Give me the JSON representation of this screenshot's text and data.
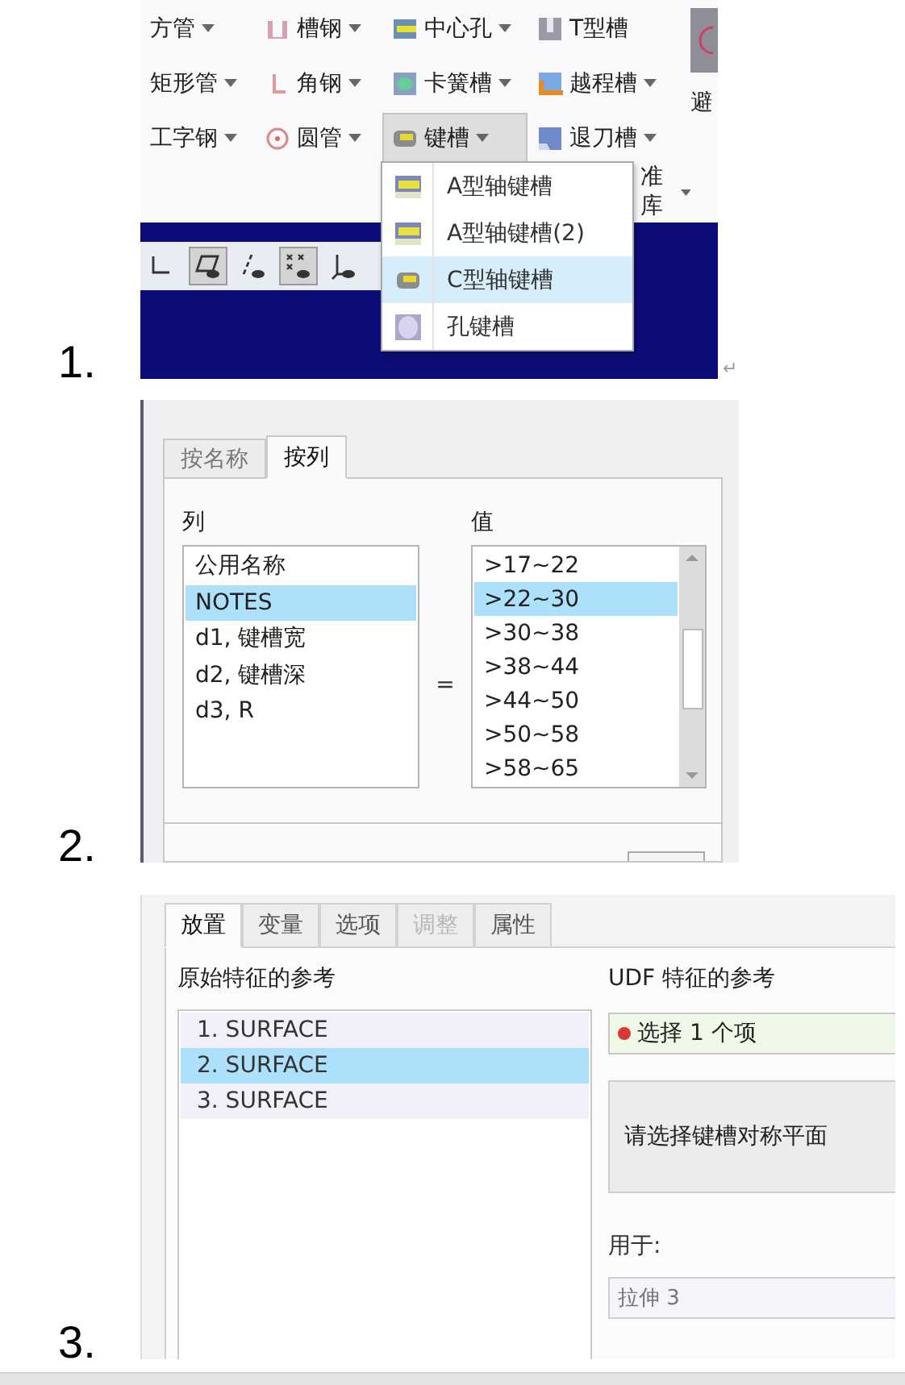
{
  "figure_1": {
    "number": "1.",
    "ribbon_rows": [
      [
        {
          "label": "方管",
          "has_dropdown": true,
          "selected": false
        },
        {
          "label": "槽钢",
          "has_dropdown": true,
          "selected": false
        },
        {
          "label": "中心孔",
          "has_dropdown": true,
          "selected": false
        },
        {
          "label": "T型槽",
          "has_dropdown": false,
          "selected": false
        }
      ],
      [
        {
          "label": "矩形管",
          "has_dropdown": true,
          "selected": false
        },
        {
          "label": "角钢",
          "has_dropdown": true,
          "selected": false
        },
        {
          "label": "卡簧槽",
          "has_dropdown": true,
          "selected": false
        },
        {
          "label": "越程槽",
          "has_dropdown": true,
          "selected": false
        }
      ],
      [
        {
          "label": "工字钢",
          "has_dropdown": true,
          "selected": false
        },
        {
          "label": "圆管",
          "has_dropdown": true,
          "selected": false
        },
        {
          "label": "键槽",
          "has_dropdown": true,
          "selected": true
        },
        {
          "label": "退刀槽",
          "has_dropdown": true,
          "selected": false
        }
      ]
    ],
    "side_label": "避",
    "library_label": "准库",
    "menu_items": [
      {
        "label": "A型轴键槽",
        "selected": false
      },
      {
        "label": "A型轴键槽(2)",
        "selected": false
      },
      {
        "label": "C型轴键槽",
        "selected": true
      },
      {
        "label": "孔键槽",
        "selected": false
      }
    ],
    "toolbar_buttons": [
      {
        "pressed": false
      },
      {
        "pressed": true
      },
      {
        "pressed": false
      },
      {
        "pressed": true
      },
      {
        "pressed": false
      }
    ],
    "paragraph_mark": "↵"
  },
  "figure_2": {
    "number": "2.",
    "tabs": [
      {
        "label": "按名称",
        "selected": false
      },
      {
        "label": "按列",
        "selected": true
      }
    ],
    "column_label": "列",
    "value_label": "值",
    "equals": "=",
    "columns": [
      {
        "label": "公用名称",
        "selected": false
      },
      {
        "label": "NOTES",
        "selected": true
      },
      {
        "label": "d1, 键槽宽",
        "selected": false
      },
      {
        "label": "d2, 键槽深",
        "selected": false
      },
      {
        "label": "d3, R",
        "selected": false
      }
    ],
    "values": [
      {
        "label": ">17~22",
        "selected": false
      },
      {
        "label": ">22~30",
        "selected": true
      },
      {
        "label": ">30~38",
        "selected": false
      },
      {
        "label": ">38~44",
        "selected": false
      },
      {
        "label": ">44~50",
        "selected": false
      },
      {
        "label": ">50~58",
        "selected": false
      },
      {
        "label": ">58~65",
        "selected": false
      }
    ]
  },
  "figure_3": {
    "number": "3.",
    "tabs": [
      {
        "label": "放置",
        "selected": true,
        "disabled": false
      },
      {
        "label": "变量",
        "selected": false,
        "disabled": false
      },
      {
        "label": "选项",
        "selected": false,
        "disabled": false
      },
      {
        "label": "调整",
        "selected": false,
        "disabled": true
      },
      {
        "label": "属性",
        "selected": false,
        "disabled": false
      }
    ],
    "left_label": "原始特征的参考",
    "references": [
      {
        "label": "1. SURFACE",
        "selected": false
      },
      {
        "label": "2. SURFACE",
        "selected": true
      },
      {
        "label": "3. SURFACE",
        "selected": false
      }
    ],
    "right_label": "UDF 特征的参考",
    "selection_field": {
      "text": "选择 1 个项",
      "color": "#d93636"
    },
    "prompt": "请选择键槽对称平面",
    "used_for_label": "用于:",
    "used_for_value": "拉伸 3"
  }
}
